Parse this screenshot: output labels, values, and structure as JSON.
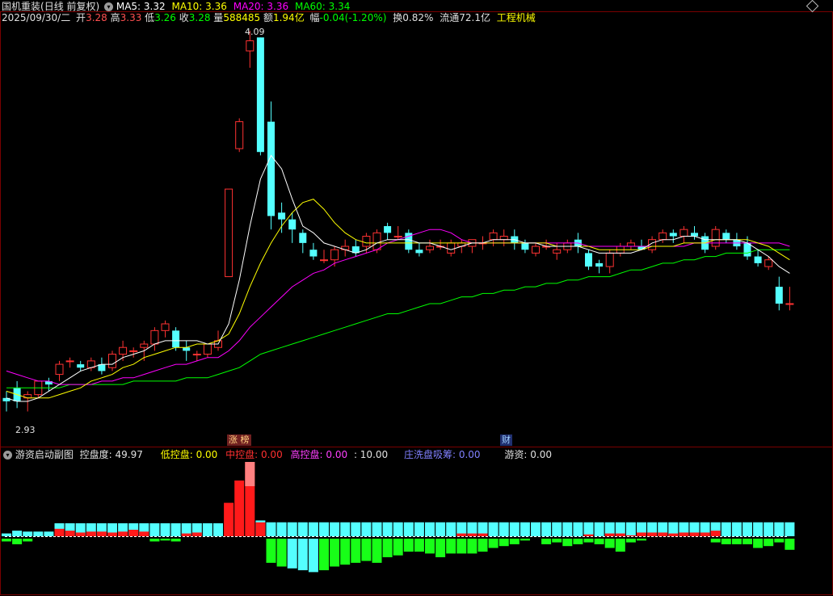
{
  "header": {
    "stock_name": "国机重装",
    "period": "(日线 前复权)",
    "ma5_label": "MA5: 3.32",
    "ma10_label": "MA10: 3.36",
    "ma20_label": "MA20: 3.36",
    "ma60_label": "MA60: 3.34",
    "date": "2025/09/30/二",
    "open_label": "开",
    "open_value": "3.28",
    "high_label": "高",
    "high_value": "3.33",
    "low_label": "低",
    "low_value": "3.26",
    "close_label": "收",
    "close_value": "3.28",
    "vol_label": "量",
    "vol_value": "588485",
    "amount_label": "额",
    "amount_value": "1.94亿",
    "change_label": "幅",
    "change_value": "-0.04(-1.20%)",
    "turnover_label": "换",
    "turnover_value": "0.82%",
    "float_label": "流通",
    "float_value": "72.1亿",
    "industry": "工程机械"
  },
  "chart_annotations": {
    "high_price": "4.09",
    "low_price": "2.93",
    "tag_zhangting": "涨 榜",
    "tag_cai": "财"
  },
  "sub_header": {
    "indicator_name": "游资启动副图",
    "control_label": "控盘度: 49.97",
    "low_control": "低控盘: 0.00",
    "mid_control": "中控盘: 0.00",
    "high_control": "高控盘: 0.00",
    "ten": ": 10.00",
    "wash": "庄洗盘吸筹: 0.00",
    "youzi": "游资: 0.00"
  },
  "colors": {
    "up": "#ff3232",
    "down": "#54ffff",
    "ma5": "#ffffff",
    "ma10": "#ffff00",
    "ma20": "#ff00ff",
    "ma60": "#00ff00",
    "bar_cyan": "#54ffff",
    "bar_red": "#ff1a1a",
    "bar_green": "#18ff18",
    "bar_pink": "#ff8080"
  },
  "chart_data": {
    "type": "candlestick",
    "price_range": [
      2.93,
      4.09
    ],
    "candles": [
      [
        3.0,
        3.02,
        2.96,
        2.99
      ],
      [
        3.03,
        3.05,
        2.97,
        2.99
      ],
      [
        3.0,
        3.02,
        2.96,
        3.01
      ],
      [
        3.01,
        3.05,
        3.0,
        3.05
      ],
      [
        3.05,
        3.06,
        3.02,
        3.04
      ],
      [
        3.07,
        3.11,
        3.05,
        3.1
      ],
      [
        3.11,
        3.12,
        3.09,
        3.11
      ],
      [
        3.1,
        3.11,
        3.08,
        3.09
      ],
      [
        3.09,
        3.12,
        3.08,
        3.11
      ],
      [
        3.1,
        3.12,
        3.07,
        3.08
      ],
      [
        3.09,
        3.14,
        3.08,
        3.13
      ],
      [
        3.13,
        3.17,
        3.11,
        3.15
      ],
      [
        3.14,
        3.15,
        3.12,
        3.14
      ],
      [
        3.15,
        3.17,
        3.11,
        3.16
      ],
      [
        3.16,
        3.21,
        3.14,
        3.2
      ],
      [
        3.2,
        3.23,
        3.18,
        3.22
      ],
      [
        3.2,
        3.21,
        3.14,
        3.15
      ],
      [
        3.15,
        3.17,
        3.11,
        3.14
      ],
      [
        3.13,
        3.14,
        3.11,
        3.13
      ],
      [
        3.13,
        3.16,
        3.12,
        3.16
      ],
      [
        3.15,
        3.2,
        3.14,
        3.17
      ],
      [
        3.36,
        3.62,
        3.36,
        3.62
      ],
      [
        3.74,
        3.83,
        3.73,
        3.82
      ],
      [
        4.03,
        4.09,
        3.98,
        4.06
      ],
      [
        4.07,
        4.07,
        3.72,
        3.73
      ],
      [
        3.82,
        3.88,
        3.5,
        3.54
      ],
      [
        3.55,
        3.58,
        3.49,
        3.53
      ],
      [
        3.53,
        3.55,
        3.46,
        3.5
      ],
      [
        3.49,
        3.5,
        3.43,
        3.46
      ],
      [
        3.44,
        3.46,
        3.41,
        3.42
      ],
      [
        3.41,
        3.44,
        3.4,
        3.41
      ],
      [
        3.41,
        3.45,
        3.39,
        3.44
      ],
      [
        3.44,
        3.47,
        3.42,
        3.45
      ],
      [
        3.45,
        3.47,
        3.42,
        3.43
      ],
      [
        3.45,
        3.49,
        3.43,
        3.48
      ],
      [
        3.44,
        3.5,
        3.43,
        3.49
      ],
      [
        3.51,
        3.52,
        3.47,
        3.49
      ],
      [
        3.48,
        3.51,
        3.47,
        3.48
      ],
      [
        3.49,
        3.5,
        3.43,
        3.44
      ],
      [
        3.44,
        3.46,
        3.42,
        3.43
      ],
      [
        3.44,
        3.47,
        3.43,
        3.45
      ],
      [
        3.45,
        3.47,
        3.44,
        3.45
      ],
      [
        3.43,
        3.47,
        3.42,
        3.46
      ],
      [
        3.45,
        3.47,
        3.43,
        3.46
      ],
      [
        3.45,
        3.47,
        3.43,
        3.47
      ],
      [
        3.46,
        3.48,
        3.44,
        3.46
      ],
      [
        3.47,
        3.5,
        3.45,
        3.49
      ],
      [
        3.47,
        3.5,
        3.45,
        3.48
      ],
      [
        3.48,
        3.5,
        3.44,
        3.46
      ],
      [
        3.46,
        3.47,
        3.43,
        3.44
      ],
      [
        3.43,
        3.46,
        3.42,
        3.45
      ],
      [
        3.45,
        3.47,
        3.44,
        3.45
      ],
      [
        3.43,
        3.46,
        3.41,
        3.44
      ],
      [
        3.44,
        3.47,
        3.43,
        3.46
      ],
      [
        3.47,
        3.49,
        3.43,
        3.45
      ],
      [
        3.43,
        3.44,
        3.38,
        3.39
      ],
      [
        3.4,
        3.41,
        3.37,
        3.39
      ],
      [
        3.39,
        3.44,
        3.37,
        3.43
      ],
      [
        3.43,
        3.46,
        3.42,
        3.45
      ],
      [
        3.45,
        3.47,
        3.44,
        3.46
      ],
      [
        3.45,
        3.47,
        3.44,
        3.44
      ],
      [
        3.44,
        3.48,
        3.43,
        3.47
      ],
      [
        3.47,
        3.5,
        3.46,
        3.49
      ],
      [
        3.49,
        3.5,
        3.46,
        3.48
      ],
      [
        3.48,
        3.51,
        3.46,
        3.5
      ],
      [
        3.49,
        3.51,
        3.47,
        3.48
      ],
      [
        3.48,
        3.49,
        3.43,
        3.44
      ],
      [
        3.45,
        3.51,
        3.44,
        3.5
      ],
      [
        3.49,
        3.5,
        3.46,
        3.47
      ],
      [
        3.47,
        3.49,
        3.44,
        3.45
      ],
      [
        3.46,
        3.48,
        3.41,
        3.42
      ],
      [
        3.42,
        3.44,
        3.39,
        3.4
      ],
      [
        3.39,
        3.42,
        3.38,
        3.41
      ],
      [
        3.33,
        3.36,
        3.26,
        3.28
      ],
      [
        3.28,
        3.33,
        3.26,
        3.28
      ]
    ],
    "ma5": [
      3.0,
      2.99,
      2.99,
      3.0,
      3.02,
      3.04,
      3.06,
      3.08,
      3.09,
      3.1,
      3.1,
      3.12,
      3.13,
      3.14,
      3.16,
      3.17,
      3.17,
      3.17,
      3.17,
      3.16,
      3.16,
      3.22,
      3.35,
      3.51,
      3.65,
      3.72,
      3.68,
      3.59,
      3.51,
      3.49,
      3.46,
      3.45,
      3.44,
      3.43,
      3.44,
      3.46,
      3.47,
      3.47,
      3.47,
      3.46,
      3.46,
      3.45,
      3.44,
      3.45,
      3.46,
      3.46,
      3.47,
      3.47,
      3.47,
      3.46,
      3.46,
      3.45,
      3.45,
      3.45,
      3.45,
      3.44,
      3.43,
      3.43,
      3.43,
      3.43,
      3.44,
      3.46,
      3.47,
      3.47,
      3.48,
      3.48,
      3.47,
      3.47,
      3.47,
      3.47,
      3.46,
      3.44,
      3.42,
      3.39,
      3.37
    ],
    "ma10": [
      3.02,
      3.01,
      3.0,
      3.0,
      3.0,
      3.01,
      3.02,
      3.03,
      3.05,
      3.06,
      3.07,
      3.09,
      3.1,
      3.12,
      3.13,
      3.14,
      3.15,
      3.15,
      3.16,
      3.16,
      3.17,
      3.19,
      3.25,
      3.33,
      3.4,
      3.46,
      3.51,
      3.55,
      3.58,
      3.59,
      3.56,
      3.52,
      3.49,
      3.47,
      3.46,
      3.46,
      3.46,
      3.46,
      3.46,
      3.46,
      3.46,
      3.46,
      3.46,
      3.46,
      3.46,
      3.46,
      3.46,
      3.46,
      3.46,
      3.46,
      3.46,
      3.46,
      3.45,
      3.45,
      3.45,
      3.45,
      3.44,
      3.44,
      3.44,
      3.44,
      3.44,
      3.45,
      3.45,
      3.45,
      3.46,
      3.46,
      3.46,
      3.47,
      3.47,
      3.47,
      3.47,
      3.46,
      3.45,
      3.43,
      3.41
    ],
    "ma20": [
      3.08,
      3.07,
      3.06,
      3.05,
      3.05,
      3.04,
      3.04,
      3.04,
      3.04,
      3.05,
      3.05,
      3.06,
      3.06,
      3.07,
      3.08,
      3.09,
      3.1,
      3.1,
      3.11,
      3.12,
      3.12,
      3.14,
      3.17,
      3.21,
      3.24,
      3.27,
      3.3,
      3.33,
      3.35,
      3.37,
      3.38,
      3.4,
      3.41,
      3.42,
      3.43,
      3.44,
      3.46,
      3.47,
      3.48,
      3.49,
      3.5,
      3.5,
      3.49,
      3.47,
      3.46,
      3.46,
      3.46,
      3.46,
      3.46,
      3.46,
      3.46,
      3.46,
      3.46,
      3.46,
      3.46,
      3.45,
      3.45,
      3.45,
      3.45,
      3.45,
      3.45,
      3.45,
      3.45,
      3.45,
      3.45,
      3.46,
      3.46,
      3.46,
      3.46,
      3.46,
      3.46,
      3.46,
      3.46,
      3.46,
      3.45
    ],
    "ma60": [
      3.03,
      3.03,
      3.03,
      3.03,
      3.03,
      3.03,
      3.04,
      3.04,
      3.04,
      3.04,
      3.04,
      3.04,
      3.05,
      3.05,
      3.05,
      3.05,
      3.05,
      3.06,
      3.06,
      3.06,
      3.07,
      3.08,
      3.09,
      3.11,
      3.13,
      3.14,
      3.15,
      3.16,
      3.17,
      3.18,
      3.19,
      3.2,
      3.21,
      3.22,
      3.23,
      3.24,
      3.25,
      3.25,
      3.26,
      3.27,
      3.28,
      3.28,
      3.29,
      3.3,
      3.3,
      3.31,
      3.31,
      3.32,
      3.32,
      3.33,
      3.33,
      3.34,
      3.34,
      3.35,
      3.35,
      3.36,
      3.36,
      3.36,
      3.37,
      3.38,
      3.38,
      3.39,
      3.4,
      3.4,
      3.41,
      3.41,
      3.42,
      3.42,
      3.43,
      3.43,
      3.43,
      3.44,
      3.44,
      3.44,
      3.44
    ],
    "sub_values_top": [
      0.3,
      0.6,
      0.5,
      0.5,
      0.5,
      1.4,
      1.4,
      1.4,
      1.4,
      1.4,
      1.4,
      1.4,
      1.4,
      1.4,
      1.4,
      1.4,
      1.4,
      1.4,
      1.4,
      1.4,
      1.4,
      3.6,
      6.0,
      8.0,
      1.7,
      1.5,
      1.5,
      1.5,
      1.5,
      1.5,
      1.5,
      1.5,
      1.5,
      1.5,
      1.5,
      1.5,
      1.5,
      1.5,
      1.5,
      1.5,
      1.5,
      1.5,
      1.5,
      1.5,
      1.5,
      1.5,
      1.5,
      1.5,
      1.5,
      1.5,
      1.5,
      1.5,
      1.5,
      1.5,
      1.5,
      1.5,
      1.5,
      1.5,
      1.5,
      1.5,
      1.5,
      1.5,
      1.5,
      1.5,
      1.5,
      1.5,
      1.5,
      1.5,
      1.5,
      1.5,
      1.5,
      1.5,
      1.5,
      1.5,
      1.5
    ],
    "sub_values_red": [
      0,
      0,
      0,
      0,
      0,
      0.8,
      0.6,
      0.4,
      0.5,
      0.5,
      0.4,
      0.5,
      0.7,
      0.5,
      0,
      0,
      0,
      0.3,
      0.4,
      0,
      0,
      3.6,
      6.0,
      7.0,
      1.5,
      0,
      0,
      0,
      0,
      0,
      0,
      0,
      0,
      0,
      0,
      0,
      0,
      0,
      0,
      0,
      0,
      0,
      0,
      0.3,
      0.3,
      0.3,
      0,
      0,
      0,
      0,
      0,
      0,
      0,
      0,
      0,
      0.2,
      0,
      0.3,
      0.3,
      0.1,
      0.4,
      0.4,
      0.4,
      0.3,
      0.4,
      0.4,
      0.4,
      0.6,
      0,
      0,
      0,
      0,
      0,
      0,
      0
    ],
    "sub_values_bottom": [
      0.3,
      0.6,
      0.3,
      0,
      0,
      0,
      0,
      0,
      0,
      0,
      0,
      0,
      0,
      0,
      0.3,
      0.2,
      0.3,
      0,
      0,
      0,
      0,
      0,
      0,
      0,
      0,
      2.6,
      3.0,
      3.2,
      3.4,
      3.6,
      3.4,
      3.0,
      2.8,
      2.6,
      2.4,
      2.6,
      2.0,
      1.8,
      1.4,
      1.4,
      1.6,
      2.0,
      1.6,
      1.6,
      1.6,
      1.4,
      1.0,
      0.8,
      0.6,
      0.2,
      0,
      0.6,
      0.4,
      0.8,
      0.6,
      0.4,
      0.6,
      1.0,
      1.4,
      0.4,
      0.2,
      0,
      0,
      0,
      0,
      0,
      0,
      0.4,
      0.6,
      0.6,
      0.6,
      1.0,
      0.8,
      0.4,
      1.2
    ]
  }
}
